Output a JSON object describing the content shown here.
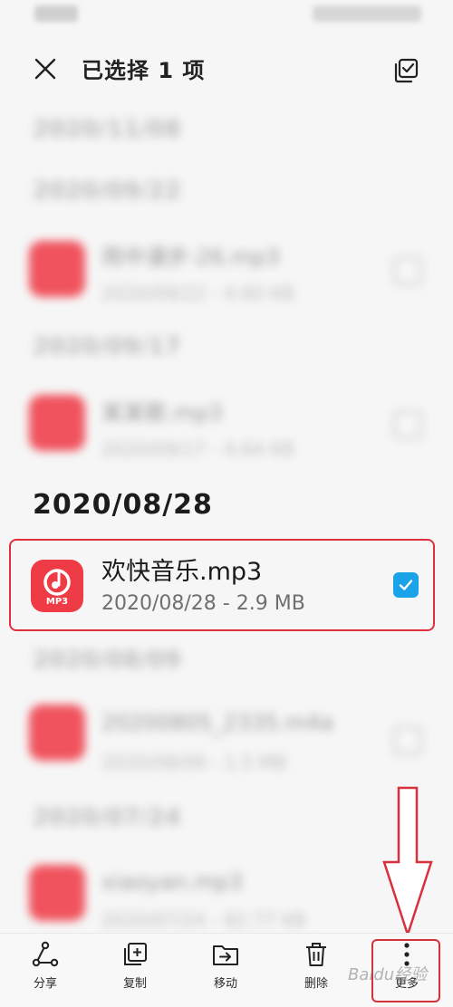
{
  "header": {
    "title": "已选择 1 项",
    "close_icon": "close-icon",
    "select_all_icon": "select-all-icon"
  },
  "blurred_list": {
    "dates": [
      "2020/11/08",
      "2020/09/22",
      "2020/09/17",
      "2020/08/09",
      "2020/07/24"
    ],
    "files": [
      {
        "name": "雨中漫步-26.mp3",
        "meta": "2020/09/22 - 4.60 KB"
      },
      {
        "name": "某某歌.mp3",
        "meta": "2020/09/17 - 4.64 KB"
      },
      {
        "name": "20200805_2335.m4a",
        "meta": "2020/08/09 - 1.5 MB"
      },
      {
        "name": "xiaoyan.mp3",
        "meta": "2020/07/24 - 82.77 KB"
      }
    ]
  },
  "selected_group": {
    "date": "2020/08/28",
    "file": {
      "name": "欢快音乐.mp3",
      "meta": "2020/08/28 - 2.9 MB",
      "icon_label": "MP3",
      "checked": true
    }
  },
  "toolbar": {
    "items": [
      {
        "label": "分享",
        "icon": "share-icon"
      },
      {
        "label": "复制",
        "icon": "copy-icon"
      },
      {
        "label": "移动",
        "icon": "move-icon"
      },
      {
        "label": "删除",
        "icon": "delete-icon"
      },
      {
        "label": "更多",
        "icon": "more-icon"
      }
    ]
  },
  "watermark": "Baidu经验",
  "colors": {
    "accent_check": "#1aa3e8",
    "icon_red": "#ef3b45",
    "highlight_red": "#e0303f"
  }
}
